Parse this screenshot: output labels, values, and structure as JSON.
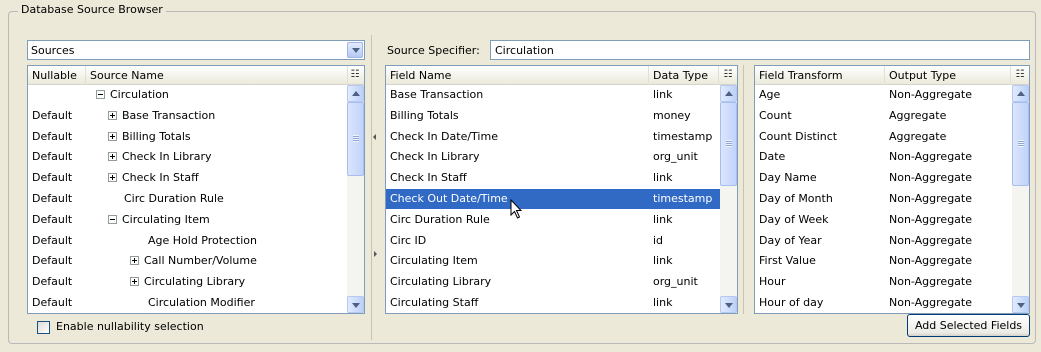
{
  "panel": {
    "title": "Database Source Browser"
  },
  "sources": {
    "combo_value": "Sources",
    "columns": [
      "Nullable",
      "Source Name"
    ],
    "rows": [
      {
        "nullable": "",
        "name": "Circulation",
        "depth": 1,
        "toggle": "minus"
      },
      {
        "nullable": "Default",
        "name": "Base Transaction",
        "depth": 2,
        "toggle": "plus"
      },
      {
        "nullable": "Default",
        "name": "Billing Totals",
        "depth": 2,
        "toggle": "plus"
      },
      {
        "nullable": "Default",
        "name": "Check In Library",
        "depth": 2,
        "toggle": "plus"
      },
      {
        "nullable": "Default",
        "name": "Check In Staff",
        "depth": 2,
        "toggle": "plus"
      },
      {
        "nullable": "Default",
        "name": "Circ Duration Rule",
        "depth": 2,
        "toggle": "none"
      },
      {
        "nullable": "Default",
        "name": "Circulating Item",
        "depth": 2,
        "toggle": "minus"
      },
      {
        "nullable": "Default",
        "name": "Age Hold Protection",
        "depth": 3,
        "toggle": "none"
      },
      {
        "nullable": "Default",
        "name": "Call Number/Volume",
        "depth": 3,
        "toggle": "plus"
      },
      {
        "nullable": "Default",
        "name": "Circulating Library",
        "depth": 3,
        "toggle": "plus"
      },
      {
        "nullable": "Default",
        "name": "Circulation Modifier",
        "depth": 3,
        "toggle": "none"
      }
    ],
    "nullability_label": "Enable nullability selection"
  },
  "fields": {
    "specifier_label": "Source Specifier:",
    "specifier_value": "Circulation",
    "columns": [
      "Field Name",
      "Data Type"
    ],
    "rows": [
      {
        "name": "Base Transaction",
        "type": "link"
      },
      {
        "name": "Billing Totals",
        "type": "money"
      },
      {
        "name": "Check In Date/Time",
        "type": "timestamp"
      },
      {
        "name": "Check In Library",
        "type": "org_unit"
      },
      {
        "name": "Check In Staff",
        "type": "link"
      },
      {
        "name": "Check Out Date/Time",
        "type": "timestamp",
        "selected": true
      },
      {
        "name": "Circ Duration Rule",
        "type": "link"
      },
      {
        "name": "Circ ID",
        "type": "id"
      },
      {
        "name": "Circulating Item",
        "type": "link"
      },
      {
        "name": "Circulating Library",
        "type": "org_unit"
      },
      {
        "name": "Circulating Staff",
        "type": "link"
      }
    ]
  },
  "transforms": {
    "columns": [
      "Field Transform",
      "Output Type"
    ],
    "rows": [
      {
        "name": "Age",
        "type": "Non-Aggregate"
      },
      {
        "name": "Count",
        "type": "Aggregate"
      },
      {
        "name": "Count Distinct",
        "type": "Aggregate"
      },
      {
        "name": "Date",
        "type": "Non-Aggregate"
      },
      {
        "name": "Day Name",
        "type": "Non-Aggregate"
      },
      {
        "name": "Day of Month",
        "type": "Non-Aggregate"
      },
      {
        "name": "Day of Week",
        "type": "Non-Aggregate"
      },
      {
        "name": "Day of Year",
        "type": "Non-Aggregate"
      },
      {
        "name": "First Value",
        "type": "Non-Aggregate"
      },
      {
        "name": "Hour",
        "type": "Non-Aggregate"
      },
      {
        "name": "Hour of day",
        "type": "Non-Aggregate"
      }
    ],
    "add_button": "Add Selected Fields"
  },
  "colors": {
    "selection": "#316ac5",
    "border": "#7f9db9",
    "background": "#ece9d8"
  },
  "icons": [
    "column-picker-icon",
    "scroll-up-icon",
    "scroll-down-icon",
    "tree-expand-icon",
    "tree-collapse-icon",
    "mouse-pointer-icon"
  ]
}
